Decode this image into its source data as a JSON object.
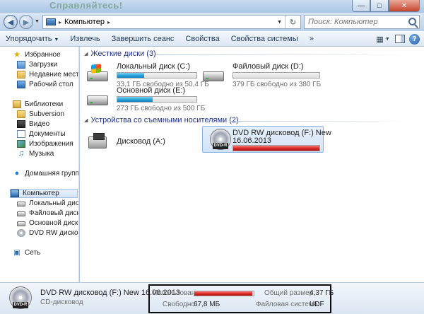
{
  "window": {
    "title_ghost": "Справляйтесь!",
    "controls": {
      "minimize": "—",
      "maximize": "□",
      "close": "✕"
    }
  },
  "address": {
    "path": "Компьютер",
    "search_placeholder": "Поиск: Компьютер"
  },
  "toolbar": {
    "organize": "Упорядочить",
    "eject": "Извлечь",
    "end_session": "Завершить сеанс",
    "properties": "Свойства",
    "system_properties": "Свойства системы",
    "more": "»"
  },
  "sidebar": {
    "favorites": "Избранное",
    "favorites_items": [
      "Загрузки",
      "Недавние места",
      "Рабочий стол"
    ],
    "libraries": "Библиотеки",
    "libraries_items": [
      "Subversion",
      "Видео",
      "Документы",
      "Изображения",
      "Музыка"
    ],
    "homegroup": "Домашняя группа",
    "computer": "Компьютер",
    "computer_items": [
      "Локальный диск (C",
      "Файловый диск (D:)",
      "Основной диск (E:)",
      "DVD RW дисковод ("
    ],
    "network": "Сеть"
  },
  "content": {
    "hard_disks_header": "Жесткие диски (3)",
    "removable_header": "Устройства со съемными носителями (2)",
    "drives": [
      {
        "name": "Локальный диск (C:)",
        "free_text": "33,1 ГБ свободно из 50,4 ГБ",
        "used_fraction": 0.34
      },
      {
        "name": "Файловый диск (D:)",
        "free_text": "379 ГБ свободно из 380 ГБ",
        "used_fraction": 0.003
      },
      {
        "name": "Основной диск (E:)",
        "free_text": "273 ГБ свободно из 500 ГБ",
        "used_fraction": 0.45
      }
    ],
    "removable": [
      {
        "name": "Дисковод (A:)"
      },
      {
        "name_line1": "DVD RW дисковод (F:) New",
        "name_line2": "16.06.2013",
        "used_fraction": 1.0,
        "badge": "DVD-R"
      }
    ]
  },
  "details": {
    "name": "DVD RW дисковод (F:) New 16.06.2013",
    "type": "CD-дисковод",
    "badge": "DVD-R",
    "used_label": "Использовано:",
    "used_fraction": 0.98,
    "free_label": "Свободно:",
    "free_value": "67,8 МБ",
    "total_label": "Общий размер:",
    "total_value": "4,37 ГБ",
    "fs_label": "Файловая система:",
    "fs_value": "UDF"
  }
}
